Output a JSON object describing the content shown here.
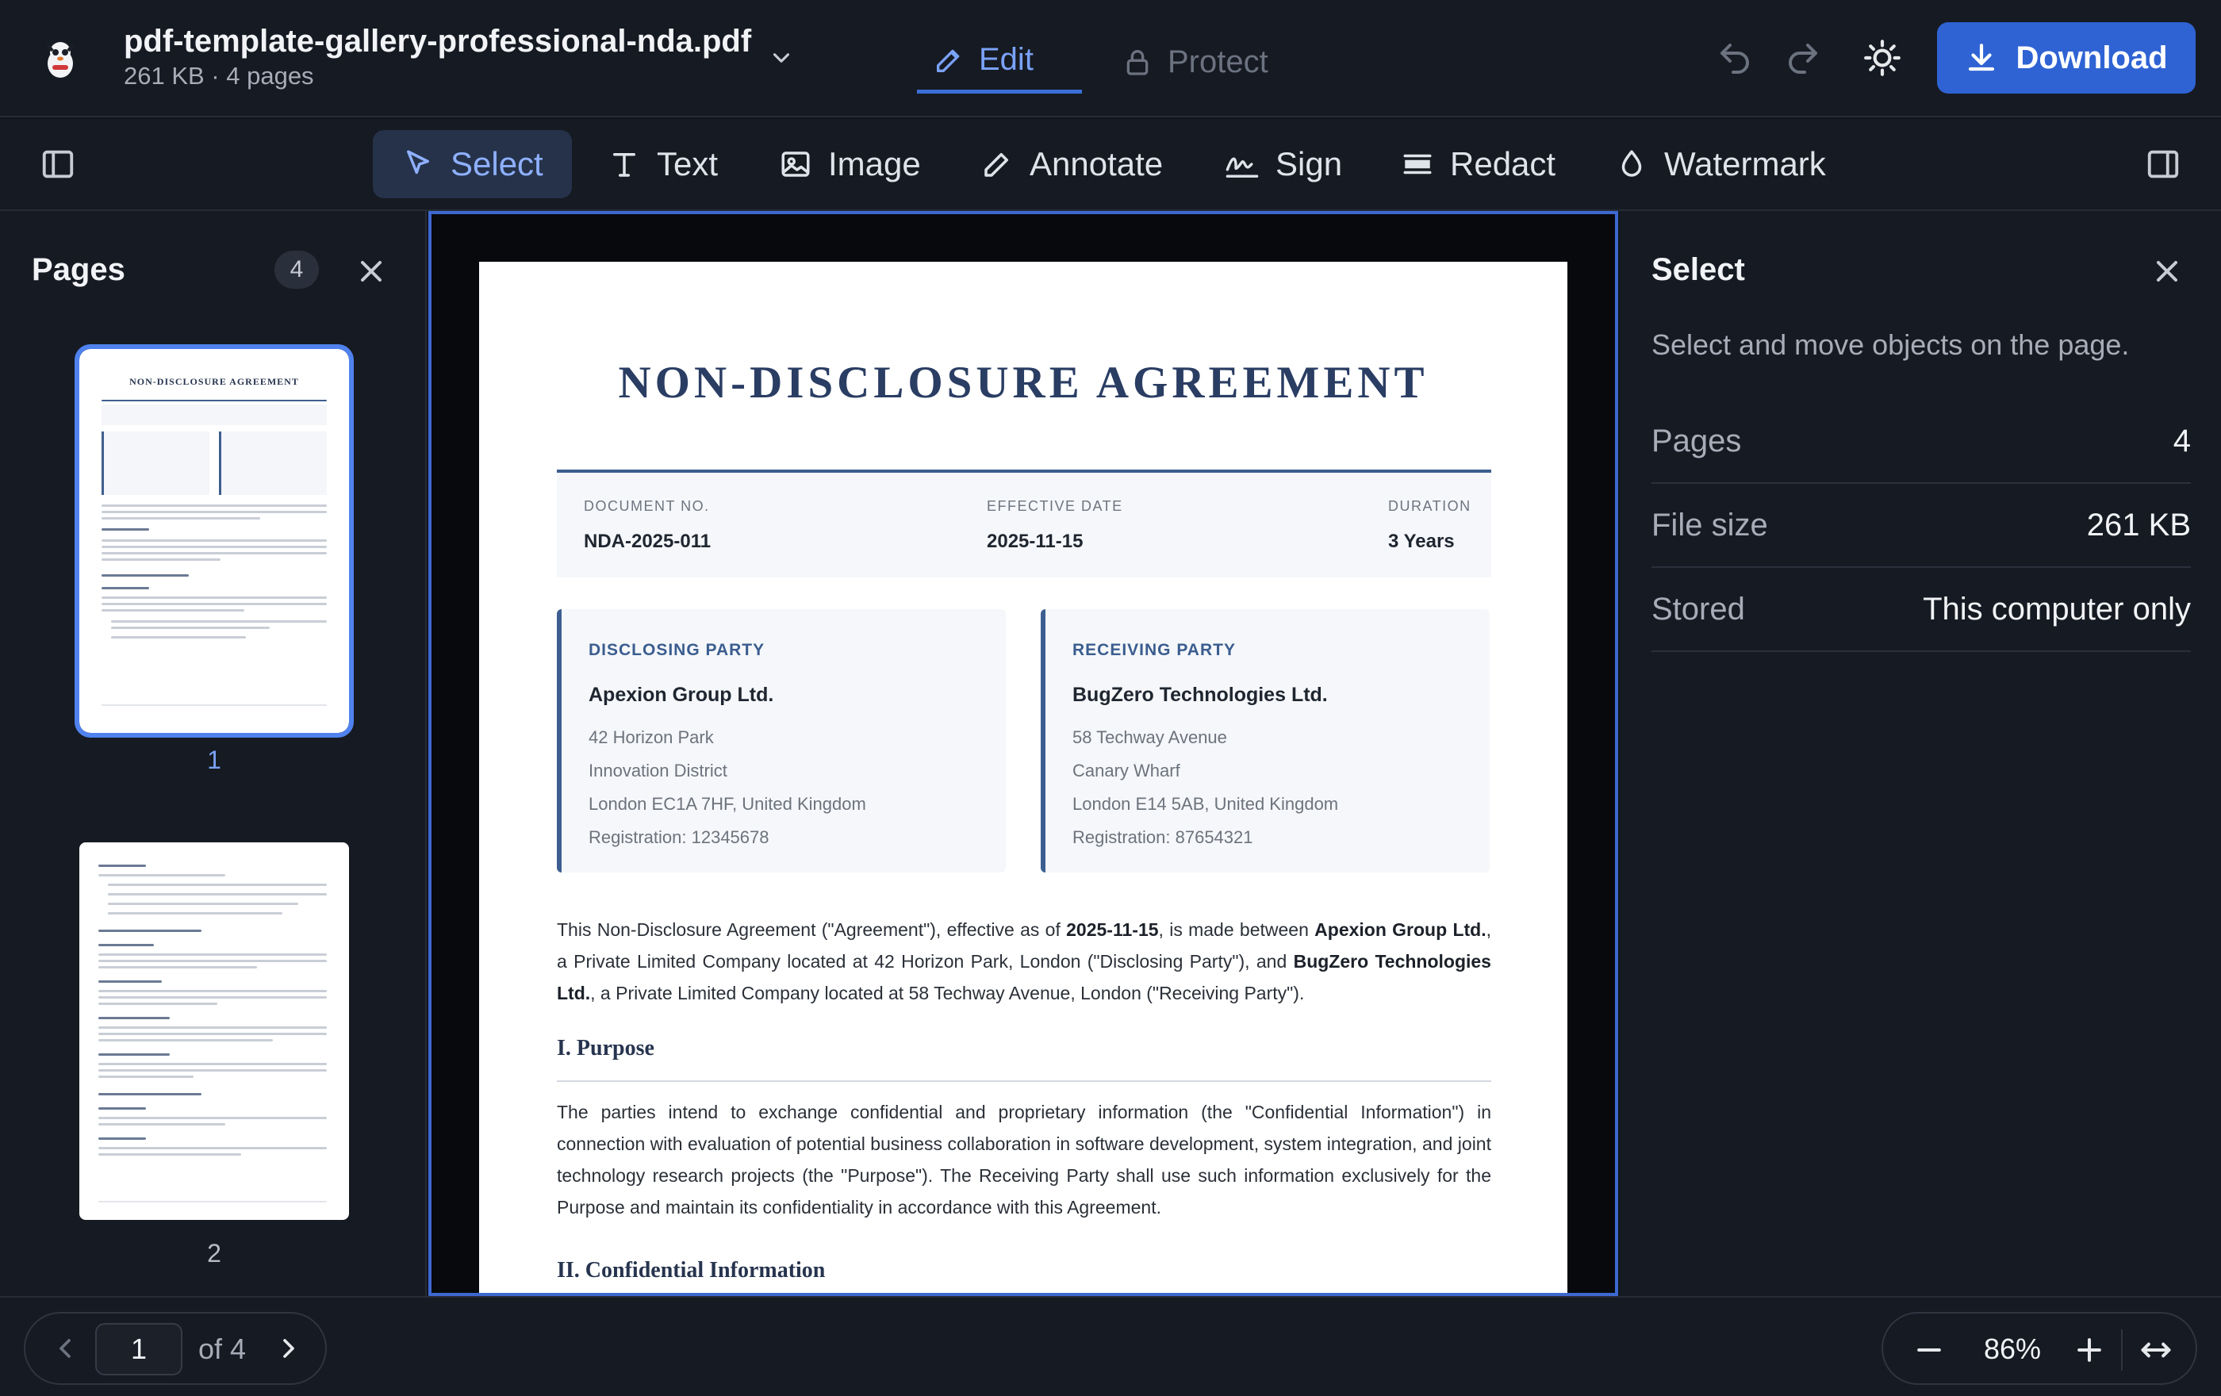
{
  "file": {
    "name": "pdf-template-gallery-professional-nda.pdf",
    "meta": "261 KB · 4 pages"
  },
  "modes": [
    {
      "label": "Edit",
      "icon": "pencil-icon",
      "active": true
    },
    {
      "label": "Protect",
      "icon": "lock-icon",
      "active": false
    }
  ],
  "header_actions": {
    "download_label": "Download"
  },
  "tools": [
    {
      "label": "Select",
      "icon": "cursor-icon",
      "active": true
    },
    {
      "label": "Text",
      "icon": "text-icon"
    },
    {
      "label": "Image",
      "icon": "image-icon"
    },
    {
      "label": "Annotate",
      "icon": "pen-icon"
    },
    {
      "label": "Sign",
      "icon": "signature-icon"
    },
    {
      "label": "Redact",
      "icon": "redact-icon"
    },
    {
      "label": "Watermark",
      "icon": "droplet-icon"
    }
  ],
  "pages_panel": {
    "title": "Pages",
    "count": "4",
    "thumbs": [
      {
        "number": "1",
        "heading": "NON-DISCLOSURE AGREEMENT",
        "selected": true
      },
      {
        "number": "2",
        "selected": false
      }
    ]
  },
  "document": {
    "title": "NON-DISCLOSURE AGREEMENT",
    "meta": [
      {
        "label": "DOCUMENT NO.",
        "value": "NDA-2025-011"
      },
      {
        "label": "EFFECTIVE DATE",
        "value": "2025-11-15"
      },
      {
        "label": "DURATION",
        "value": "3 Years"
      }
    ],
    "parties": [
      {
        "role": "DISCLOSING PARTY",
        "name": "Apexion Group Ltd.",
        "lines": [
          "42 Horizon Park",
          "Innovation District",
          "London EC1A 7HF, United Kingdom",
          "Registration: 12345678"
        ]
      },
      {
        "role": "RECEIVING PARTY",
        "name": "BugZero Technologies Ltd.",
        "lines": [
          "58 Techway Avenue",
          "Canary Wharf",
          "London E14 5AB, United Kingdom",
          "Registration: 87654321"
        ]
      }
    ],
    "intro": {
      "t1": "This Non-Disclosure Agreement (\"Agreement\"), effective as of ",
      "date": "2025-11-15",
      "t2": ", is made between ",
      "party1": "Apexion Group Ltd.",
      "t3": ", a Private Limited Company located at 42 Horizon Park, London (\"Disclosing Party\"), and ",
      "party2": "BugZero Technologies Ltd.",
      "t4": ", a Private Limited Company located at 58 Techway Avenue, London (\"Receiving Party\")."
    },
    "section1_title": "I. Purpose",
    "section1_body": "The parties intend to exchange confidential and proprietary information (the \"Confidential Information\") in connection with evaluation of potential business collaboration in software development, system integration, and joint technology research projects (the \"Purpose\"). The Receiving Party shall use such information exclusively for the Purpose and maintain its confidentiality in accordance with this Agreement.",
    "section2_title": "II. Confidential Information"
  },
  "properties": {
    "title": "Select",
    "description": "Select and move objects on the page.",
    "rows": [
      {
        "key": "Pages",
        "value": "4"
      },
      {
        "key": "File size",
        "value": "261 KB"
      },
      {
        "key": "Stored",
        "value": "This computer only"
      }
    ]
  },
  "pager": {
    "current": "1",
    "of_label": "of 4"
  },
  "zoom": {
    "value": "86%"
  },
  "colors": {
    "accent": "#2f63d4",
    "active_text": "#7aa2f7",
    "doc_heading": "#2a3d63",
    "background": "#11151c"
  }
}
